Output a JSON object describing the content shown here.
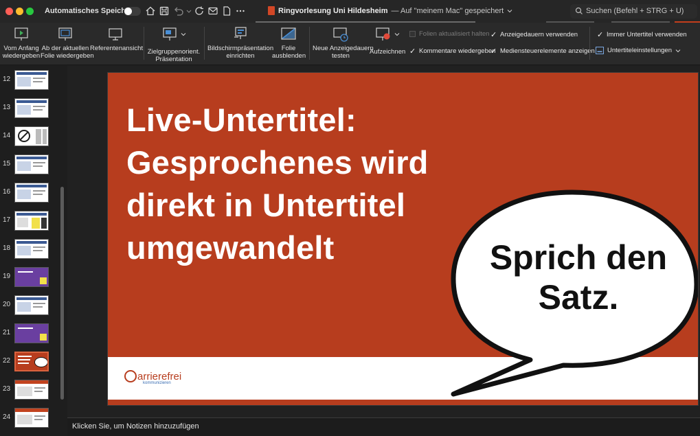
{
  "titlebar": {
    "autosave_label": "Automatisches Speichern",
    "document_title": "Ringvorlesung Uni Hildesheim",
    "document_status": "— Auf \"meinem Mac\" gespeichert",
    "search_placeholder": "Suchen (Befehl + STRG + U)",
    "icons": [
      "home-icon",
      "save-icon",
      "undo-icon",
      "redo-icon",
      "mail-icon",
      "new-document-icon",
      "more-icon"
    ]
  },
  "ribbon": {
    "buttons": [
      {
        "label_line1": "Vom Anfang",
        "label_line2": "wiedergeben",
        "icon": "play-from-start-icon"
      },
      {
        "label_line1": "Ab der aktuellen",
        "label_line2": "Folie wiedergeben",
        "icon": "play-from-current-icon"
      },
      {
        "label_line1": "Referentenansicht",
        "label_line2": "",
        "icon": "presenter-view-icon"
      },
      {
        "label_line1": "Zielgruppenorient.",
        "label_line2": "Präsentation",
        "icon": "custom-show-icon"
      },
      {
        "label_line1": "Bildschirmpräsentation",
        "label_line2": "einrichten",
        "icon": "setup-show-icon"
      },
      {
        "label_line1": "Folie",
        "label_line2": "ausblenden",
        "icon": "hide-slide-icon"
      },
      {
        "label_line1": "Neue Anzeigedauern",
        "label_line2": "testen",
        "icon": "rehearse-timings-icon"
      },
      {
        "label_line1": "Aufzeichnen",
        "label_line2": "",
        "icon": "record-icon"
      }
    ],
    "checks": [
      {
        "label": "Folien aktualisiert halten",
        "checked": false,
        "enabled": false
      },
      {
        "label": "Kommentare wiedergeben",
        "checked": true,
        "enabled": true
      },
      {
        "label": "Anzeigedauern verwenden",
        "checked": true,
        "enabled": true
      },
      {
        "label": "Mediensteuerelemente anzeigen",
        "checked": true,
        "enabled": true
      },
      {
        "label": "Immer Untertitel verwenden",
        "checked": true,
        "enabled": true
      }
    ],
    "subtitle_settings_label": "Untertiteleinstellungen"
  },
  "thumbnails": {
    "items": [
      {
        "number": "12",
        "style": "blue"
      },
      {
        "number": "13",
        "style": "blue"
      },
      {
        "number": "14",
        "style": "nosign"
      },
      {
        "number": "15",
        "style": "blue"
      },
      {
        "number": "16",
        "style": "blue"
      },
      {
        "number": "17",
        "style": "yellow"
      },
      {
        "number": "18",
        "style": "blue"
      },
      {
        "number": "19",
        "style": "purple"
      },
      {
        "number": "20",
        "style": "blue"
      },
      {
        "number": "21",
        "style": "purple"
      },
      {
        "number": "22",
        "style": "current"
      },
      {
        "number": "23",
        "style": "orange"
      },
      {
        "number": "24",
        "style": "orange"
      }
    ],
    "selected": "22"
  },
  "slide": {
    "title_lines": [
      "Live-Untertitel:",
      "Gesprochenes wird",
      "direkt in Untertitel",
      "umgewandelt"
    ],
    "bubble_lines": [
      "Sprich den",
      "Satz."
    ],
    "logo_text": "arrierefrei",
    "logo_sub": "kommunizieren",
    "colors": {
      "background": "#b73d1e",
      "footer": "#ffffff",
      "text": "#ffffff"
    }
  },
  "notes": {
    "placeholder": "Klicken Sie, um Notizen hinzuzufügen"
  }
}
